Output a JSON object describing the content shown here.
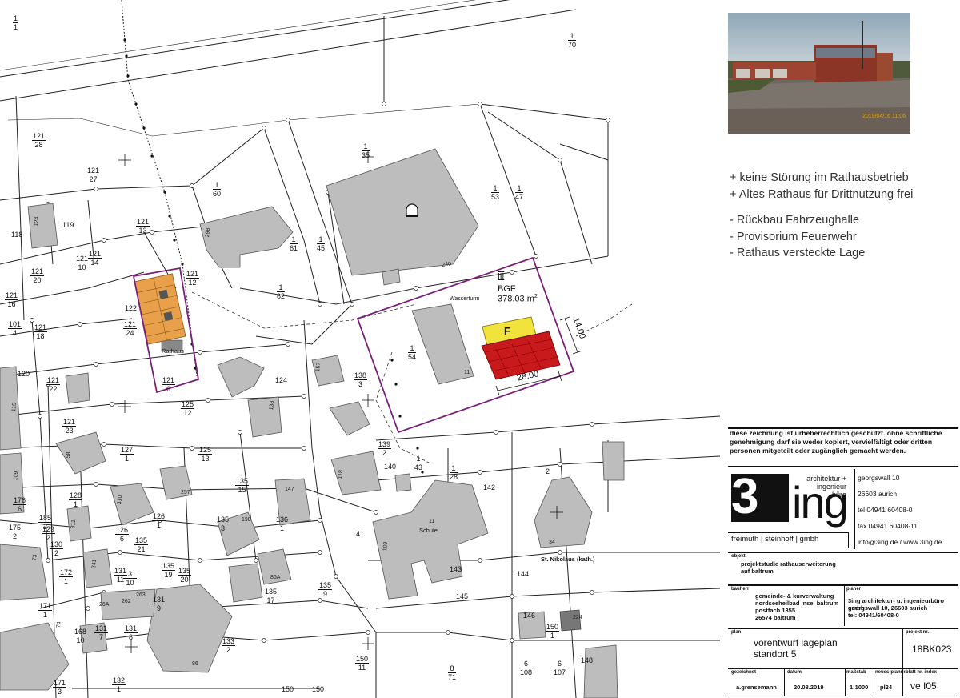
{
  "parcels": [
    {
      "num": "1",
      "den": "1"
    },
    {
      "num": "1",
      "den": "70"
    },
    {
      "num": "121",
      "den": "28"
    },
    {
      "num": "121",
      "den": "27"
    },
    {
      "num": "1",
      "den": "60"
    },
    {
      "num": "1",
      "den": "35"
    },
    {
      "num": "1",
      "den": "53"
    },
    {
      "num": "1",
      "den": "47"
    },
    {
      "num": "121",
      "den": "13"
    },
    {
      "num": "1",
      "den": "61"
    },
    {
      "num": "1",
      "den": "45"
    },
    {
      "num": "121",
      "den": "14"
    },
    {
      "num": "121",
      "den": "10"
    },
    {
      "num": "121",
      "den": "20"
    },
    {
      "num": "121",
      "den": "12"
    },
    {
      "num": "121",
      "den": "16"
    },
    {
      "num": "1",
      "den": "62"
    },
    {
      "num": "121",
      "den": "24"
    },
    {
      "num": "121",
      "den": "18"
    },
    {
      "num": "101",
      "den": "4"
    },
    {
      "num": "121",
      "den": "22"
    },
    {
      "num": "121",
      "den": "6"
    },
    {
      "num": "125",
      "den": "12"
    },
    {
      "num": "138",
      "den": "3"
    },
    {
      "num": "1",
      "den": "54"
    },
    {
      "num": "121",
      "den": "23"
    },
    {
      "num": "127",
      "den": "1"
    },
    {
      "num": "125",
      "den": "13"
    },
    {
      "num": "139",
      "den": "2"
    },
    {
      "num": "1",
      "den": "43"
    },
    {
      "num": "1",
      "den": "28"
    },
    {
      "num": "128",
      "den": "1"
    },
    {
      "num": "135",
      "den": "15"
    },
    {
      "num": "176",
      "den": "6"
    },
    {
      "num": "185",
      "den": "2"
    },
    {
      "num": "126",
      "den": "1"
    },
    {
      "num": "135",
      "den": "3"
    },
    {
      "num": "136",
      "den": "1"
    },
    {
      "num": "175",
      "den": "2"
    },
    {
      "num": "129",
      "den": "2"
    },
    {
      "num": "126",
      "den": "6"
    },
    {
      "num": "135",
      "den": "21"
    },
    {
      "num": "130",
      "den": "2"
    },
    {
      "num": "172",
      "den": "1"
    },
    {
      "num": "131",
      "den": "11"
    },
    {
      "num": "131",
      "den": "10"
    },
    {
      "num": "135",
      "den": "19"
    },
    {
      "num": "135",
      "den": "20"
    },
    {
      "num": "135",
      "den": "17"
    },
    {
      "num": "135",
      "den": "9"
    },
    {
      "num": "171",
      "den": "1"
    },
    {
      "num": "131",
      "den": "9"
    },
    {
      "num": "131",
      "den": "7"
    },
    {
      "num": "131",
      "den": "8"
    },
    {
      "num": "168",
      "den": "10"
    },
    {
      "num": "133",
      "den": "2"
    },
    {
      "num": "150",
      "den": "11"
    },
    {
      "num": "8",
      "den": "71"
    },
    {
      "num": "6",
      "den": "108"
    },
    {
      "num": "6",
      "den": "107"
    },
    {
      "num": "150",
      "den": "1"
    },
    {
      "num": "132",
      "den": "1"
    },
    {
      "num": "171",
      "den": "3"
    }
  ],
  "plain_numbers": [
    "118",
    "119",
    "122",
    "120",
    "124",
    "140",
    "142",
    "141",
    "143",
    "144",
    "145",
    "146",
    "148",
    "2",
    "150",
    "150"
  ],
  "building_labels": [
    "124",
    "298",
    "240",
    "157",
    "138",
    "11",
    "118",
    "11",
    "109",
    "147",
    "198",
    "257",
    "310",
    "311",
    "241",
    "58",
    "86",
    "86A",
    "262",
    "263",
    "26A",
    "224",
    "73",
    "74",
    "34",
    "109",
    "115"
  ],
  "place_labels": {
    "rathaus": "Rathaus",
    "schule": "Schule",
    "wasserturm": "Wasserturm",
    "kirche": "St. Nikolaus (kath.)"
  },
  "drawing": {
    "storeys": "III",
    "bgf_label": "BGF",
    "area_value": "378.03 m",
    "area_unit_sup": "2",
    "dim_width": "28.00",
    "dim_depth": "14.00",
    "block_letter": "F"
  },
  "photo": {
    "date_stamp": "2019/04/16 11:06"
  },
  "notes": {
    "pros": [
      "+ keine Störung im Rathausbetrieb",
      "+ Altes Rathaus für Drittnutzung frei"
    ],
    "cons": [
      "- Rückbau Fahrzeughalle",
      "- Provisorium Feuerwehr",
      "- Rathaus versteckte Lage"
    ]
  },
  "title_block": {
    "copyright": "diese zeichnung ist urheberrechtlich geschützt. ohne schriftliche genehmigung darf sie weder kopiert, vervielfältigt oder dritten personen mitgeteilt oder zugänglich gemacht werden.",
    "logo": {
      "big": "3",
      "word": "ing",
      "sub_line1": "architektur +",
      "sub_line2": "ingenieur",
      "sub_line3": "büro",
      "names": "freimuth | steinhoff | gmbh"
    },
    "contact": [
      "georgswall 10",
      "26603 aurich",
      "tel 04941 60408-0",
      "fax 04941 60408-11",
      "info@3ing.de / www.3ing.de"
    ],
    "objekt_label": "objekt",
    "objekt_lines": [
      "projektstudie rathauserweiterung",
      "auf baltrum"
    ],
    "bauherr_label": "bauherr",
    "bauherr_lines": [
      "gemeinde- & kurverwaltung",
      "nordseeheilbad insel baltrum",
      "postfach 1355",
      "26574 baltrum"
    ],
    "planer_label": "planer",
    "planer_lines": [
      "3ing architektur- u. ingenieurbüro gmbh",
      "georgswall 10, 26603 aurich",
      "tel: 04941/60408-0"
    ],
    "plan_label": "plan",
    "plan_lines": [
      "vorentwurf lageplan",
      "standort 5"
    ],
    "projekt_label": "projekt nr.",
    "projekt_nr": "18BK023",
    "headers": {
      "gezeichnet": "gezeichnet",
      "datum": "datum",
      "massstab": "maßstab",
      "plannr": "neues-plannr.",
      "blatt": "blatt nr. index"
    },
    "values": {
      "gezeichnet": "a.grensemann",
      "datum": "20.08.2019",
      "massstab": "1:1000",
      "plannr": "pl24",
      "blatt": "ve I05"
    }
  }
}
